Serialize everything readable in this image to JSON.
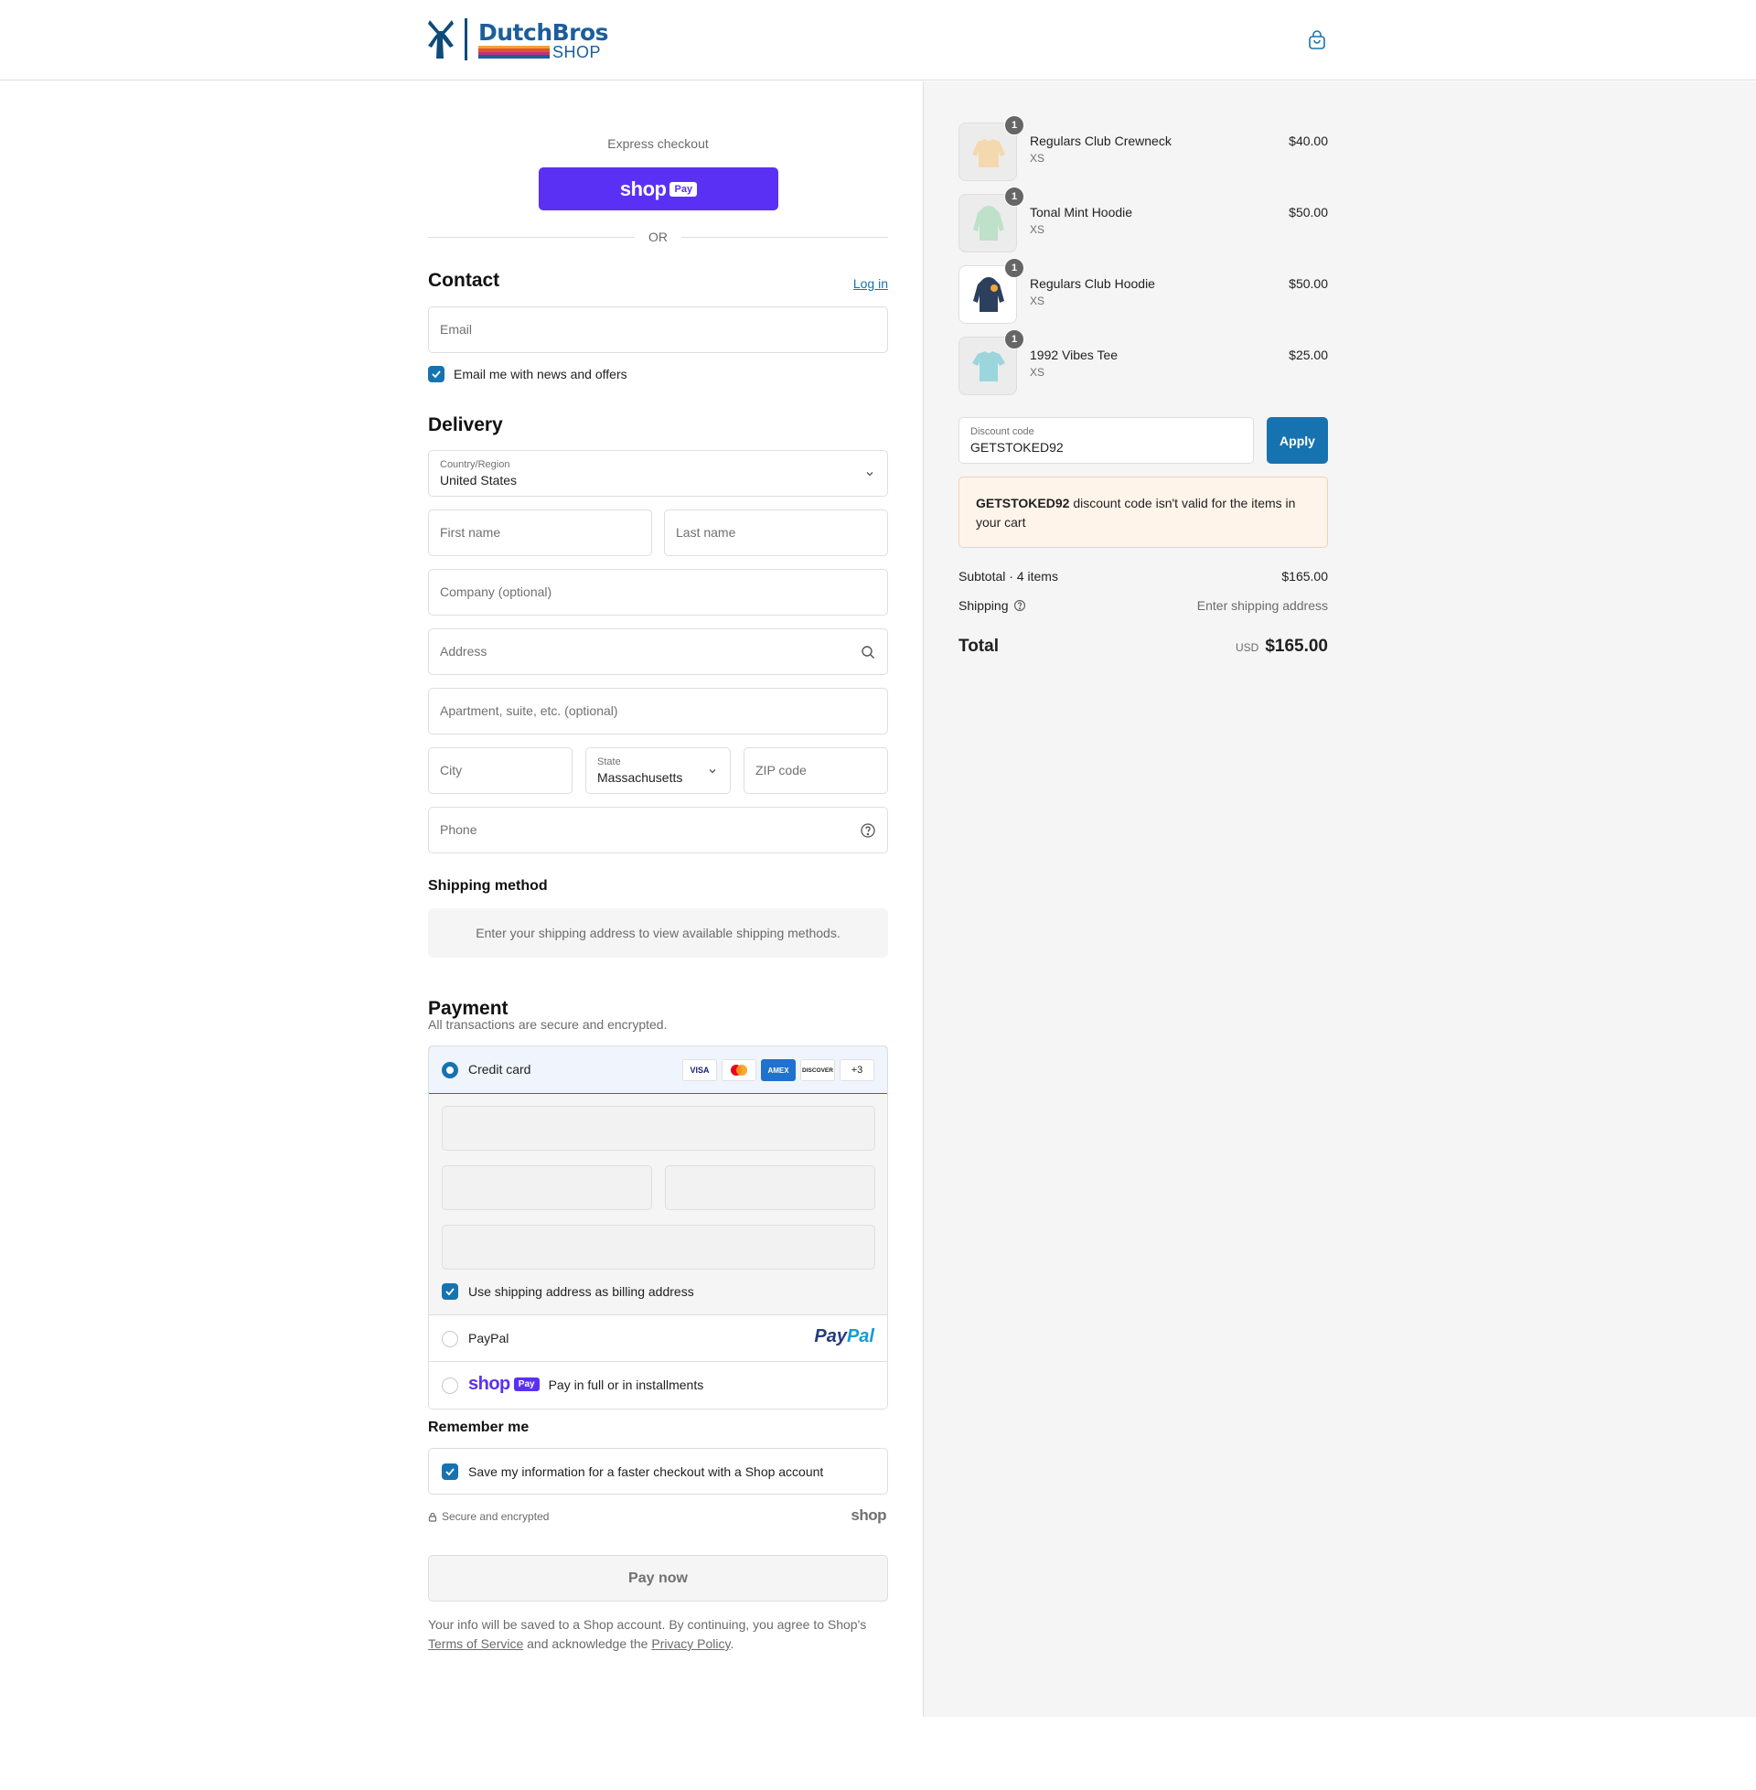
{
  "brand": {
    "name_top": "DutchBros",
    "name_bottom": "SHOP",
    "stripe_colors": [
      "#f0a33a",
      "#e3532f",
      "#c0347e",
      "#1b5e9c"
    ]
  },
  "express": {
    "label": "Express checkout",
    "shoppay_word": "shop",
    "shoppay_badge": "Pay",
    "or": "OR"
  },
  "contact": {
    "title": "Contact",
    "login": "Log in",
    "email_placeholder": "Email",
    "newsletter_label": "Email me with news and offers",
    "newsletter_checked": true
  },
  "delivery": {
    "title": "Delivery",
    "country_label": "Country/Region",
    "country_value": "United States",
    "first_name": "First name",
    "last_name": "Last name",
    "company": "Company (optional)",
    "address": "Address",
    "apartment": "Apartment, suite, etc. (optional)",
    "city": "City",
    "state_label": "State",
    "state_value": "Massachusetts",
    "zip": "ZIP code",
    "phone": "Phone"
  },
  "shipping_method": {
    "title": "Shipping method",
    "info": "Enter your shipping address to view available shipping methods."
  },
  "payment": {
    "title": "Payment",
    "subtitle": "All transactions are secure and encrypted.",
    "credit_card_label": "Credit card",
    "card_brands": [
      "VISA",
      "mastercard",
      "AMEX",
      "DISCOVER"
    ],
    "more_cards": "+3",
    "billing_same_label": "Use shipping address as billing address",
    "paypal_label": "PayPal",
    "paypal_logo": "PayPal",
    "shoppay_word": "shop",
    "shoppay_badge": "Pay",
    "shoppay_text": "Pay in full or in installments",
    "accent": "#1773b0"
  },
  "remember": {
    "title": "Remember me",
    "save_label": "Save my information for a faster checkout with a Shop account",
    "secure_text": "Secure and encrypted",
    "shop_mark": "shop"
  },
  "pay_now": "Pay now",
  "legal": {
    "text1": "Your info will be saved to a Shop account. By continuing, you agree to Shop's",
    "terms": "Terms of Service",
    "text2": "and acknowledge the",
    "privacy": "Privacy Policy",
    "text3": "."
  },
  "cart": {
    "items": [
      {
        "name": "Regulars Club Crewneck",
        "variant": "XS",
        "price": "$40.00",
        "qty": "1",
        "color": "#f3d9ad"
      },
      {
        "name": "Tonal Mint Hoodie",
        "variant": "XS",
        "price": "$50.00",
        "qty": "1",
        "color": "#bfe0c9"
      },
      {
        "name": "Regulars Club Hoodie",
        "variant": "XS",
        "price": "$50.00",
        "qty": "1",
        "color": "#2c3f5c"
      },
      {
        "name": "1992 Vibes Tee",
        "variant": "XS",
        "price": "$25.00",
        "qty": "1",
        "color": "#9ad6dc"
      }
    ],
    "discount_label": "Discount code",
    "discount_value": "GETSTOKED92",
    "apply": "Apply",
    "notice_code": "GETSTOKED92",
    "notice_text": "discount code isn't valid for the items in your cart",
    "subtotal_label": "Subtotal · 4 items",
    "subtotal_value": "$165.00",
    "shipping_label": "Shipping",
    "shipping_value": "Enter shipping address",
    "total_label": "Total",
    "currency": "USD",
    "total_value": "$165.00"
  }
}
